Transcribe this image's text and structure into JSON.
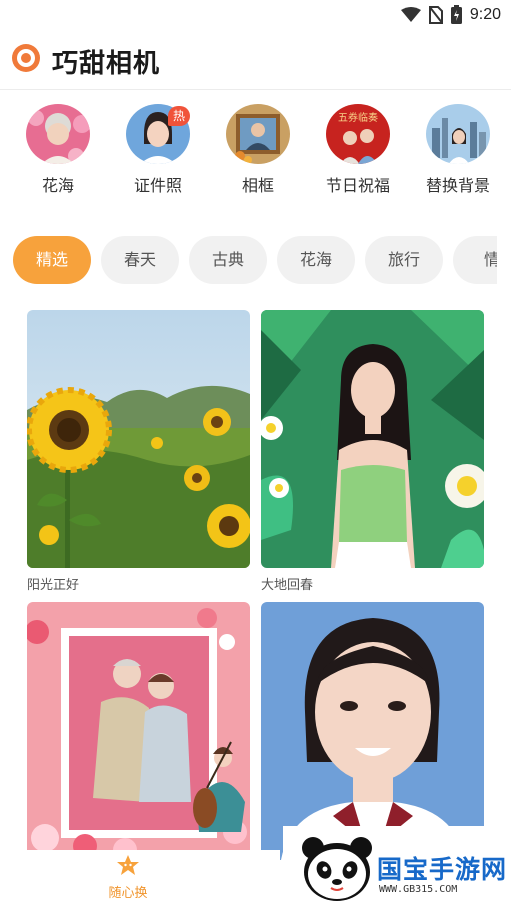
{
  "status_bar": {
    "time": "9:20",
    "icons": [
      "wifi-icon",
      "no-sim-icon",
      "battery-icon"
    ]
  },
  "app": {
    "title": "巧甜相机",
    "accent_color": "#f07a3a"
  },
  "categories": [
    {
      "label": "花海",
      "icon": "flower-portrait"
    },
    {
      "label": "证件照",
      "icon": "id-photo",
      "badge": "热"
    },
    {
      "label": "相框",
      "icon": "photo-frame"
    },
    {
      "label": "节日祝福",
      "icon": "festival-greeting",
      "banner_text": "五券临奏"
    },
    {
      "label": "替换背景",
      "icon": "city-background"
    }
  ],
  "tabs": {
    "items": [
      "精选",
      "春天",
      "古典",
      "花海",
      "旅行",
      "情"
    ],
    "active_index": 0,
    "active_color": "#f7a23c"
  },
  "templates": [
    {
      "label": "阳光正好"
    },
    {
      "label": "大地回春"
    },
    {
      "label": ""
    },
    {
      "label": ""
    }
  ],
  "bottom_nav": {
    "label": "随心换",
    "color": "#f0942c"
  },
  "watermark": {
    "text": "国宝手游网",
    "url": "WWW.GB315.COM"
  }
}
